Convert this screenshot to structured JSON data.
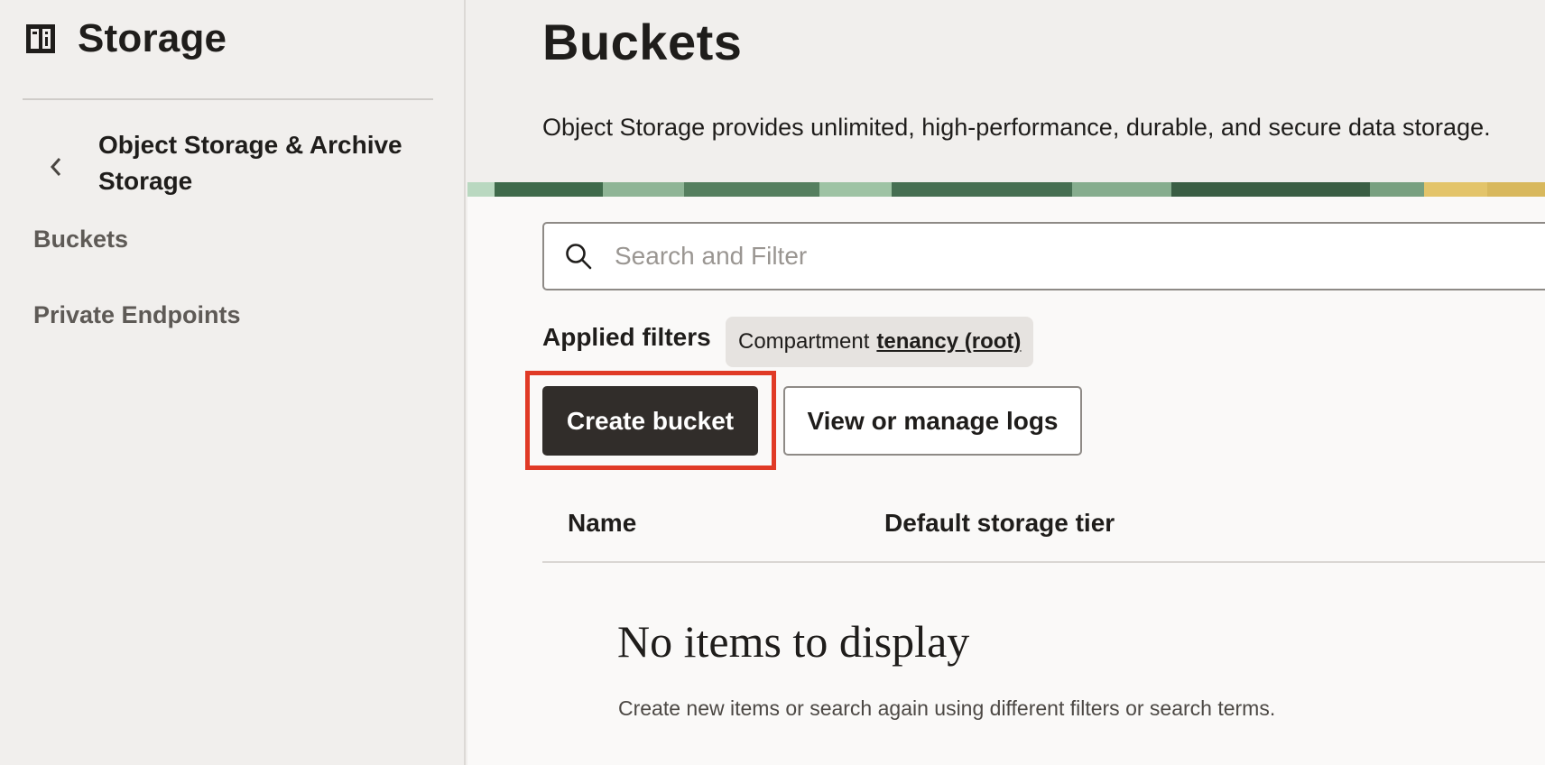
{
  "service": {
    "title": "Storage",
    "icon": "storage-panel-icon"
  },
  "sidebar": {
    "back_icon": "chevron-left-icon",
    "section_title": "Object Storage & Archive Storage",
    "items": [
      {
        "label": "Buckets"
      },
      {
        "label": "Private Endpoints"
      }
    ]
  },
  "page": {
    "title": "Buckets",
    "description": "Object Storage provides unlimited, high-performance, durable, and secure data storage."
  },
  "search": {
    "placeholder": "Search and Filter",
    "value": "",
    "icon": "search-icon"
  },
  "filters": {
    "label": "Applied filters",
    "chip": {
      "key": "Compartment",
      "value": "tenancy (root)"
    }
  },
  "actions": {
    "create_label": "Create bucket",
    "logs_label": "View or manage logs",
    "highlight_color": "#e03a26"
  },
  "table": {
    "columns": [
      "Name",
      "Default storage tier"
    ],
    "empty_title": "No items to display",
    "empty_description": "Create new items or search again using different filters or search terms."
  },
  "colors": {
    "primary_button": "#312d2a",
    "background": "#f1efed",
    "content_background": "#faf9f8"
  }
}
